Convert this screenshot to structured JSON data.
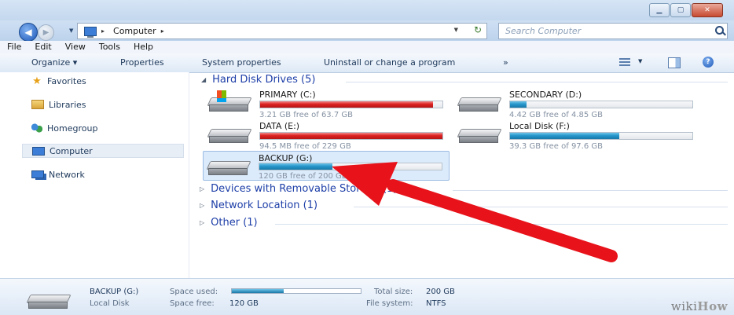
{
  "window": {
    "minimize_glyph": "▁",
    "maximize_glyph": "▢",
    "close_glyph": "✕"
  },
  "address": {
    "back_glyph": "◀",
    "forward_glyph": "▶",
    "dropdown_glyph": "▼",
    "path_arrow": "▸",
    "location": "Computer",
    "trail_arrow": "▸",
    "refresh_glyph": "↻",
    "search_placeholder": "Search Computer"
  },
  "menu": [
    "File",
    "Edit",
    "View",
    "Tools",
    "Help"
  ],
  "commands": {
    "organize": "Organize ▾",
    "properties": "Properties",
    "system_properties": "System properties",
    "uninstall": "Uninstall or change a program",
    "more": "»",
    "help_glyph": "?"
  },
  "nav": {
    "favorites": "Favorites",
    "libraries": "Libraries",
    "homegroup": "Homegroup",
    "computer": "Computer",
    "network": "Network",
    "star_glyph": "★"
  },
  "groups": {
    "hard_disks": "Hard Disk Drives (5)",
    "removable": "Devices with Removable Storage (1)",
    "network_location": "Network Location (1)",
    "other": "Other (1)",
    "expanded_glyph": "◢",
    "collapsed_glyph": "▷"
  },
  "drives": [
    {
      "name": "PRIMARY (C:)",
      "free": "3.21 GB free of 63.7 GB",
      "used_fraction": 0.95,
      "color": "red"
    },
    {
      "name": "SECONDARY (D:)",
      "free": "4.42 GB free of 4.85 GB",
      "used_fraction": 0.09,
      "color": "blue"
    },
    {
      "name": "DATA (E:)",
      "free": "94.5 MB free of 229 GB",
      "used_fraction": 1.0,
      "color": "red"
    },
    {
      "name": "Local Disk (F:)",
      "free": "39.3 GB free of 97.6 GB",
      "used_fraction": 0.6,
      "color": "blue"
    },
    {
      "name": "BACKUP (G:)",
      "free": "120 GB free of 200 GB",
      "used_fraction": 0.4,
      "color": "blue"
    }
  ],
  "details": {
    "drive_name": "BACKUP (G:)",
    "drive_type": "Local Disk",
    "space_used_label": "Space used:",
    "space_used_fraction": 0.4,
    "space_free_label": "Space free:",
    "space_free_value": "120 GB",
    "total_size_label": "Total size:",
    "total_size_value": "200 GB",
    "file_system_label": "File system:",
    "file_system_value": "NTFS"
  },
  "watermark": {
    "wiki": "wiki",
    "how": "How"
  },
  "colors": {
    "used_red": "#dd2222",
    "used_blue": "#2696cb",
    "arrow_red": "#e8121a"
  }
}
